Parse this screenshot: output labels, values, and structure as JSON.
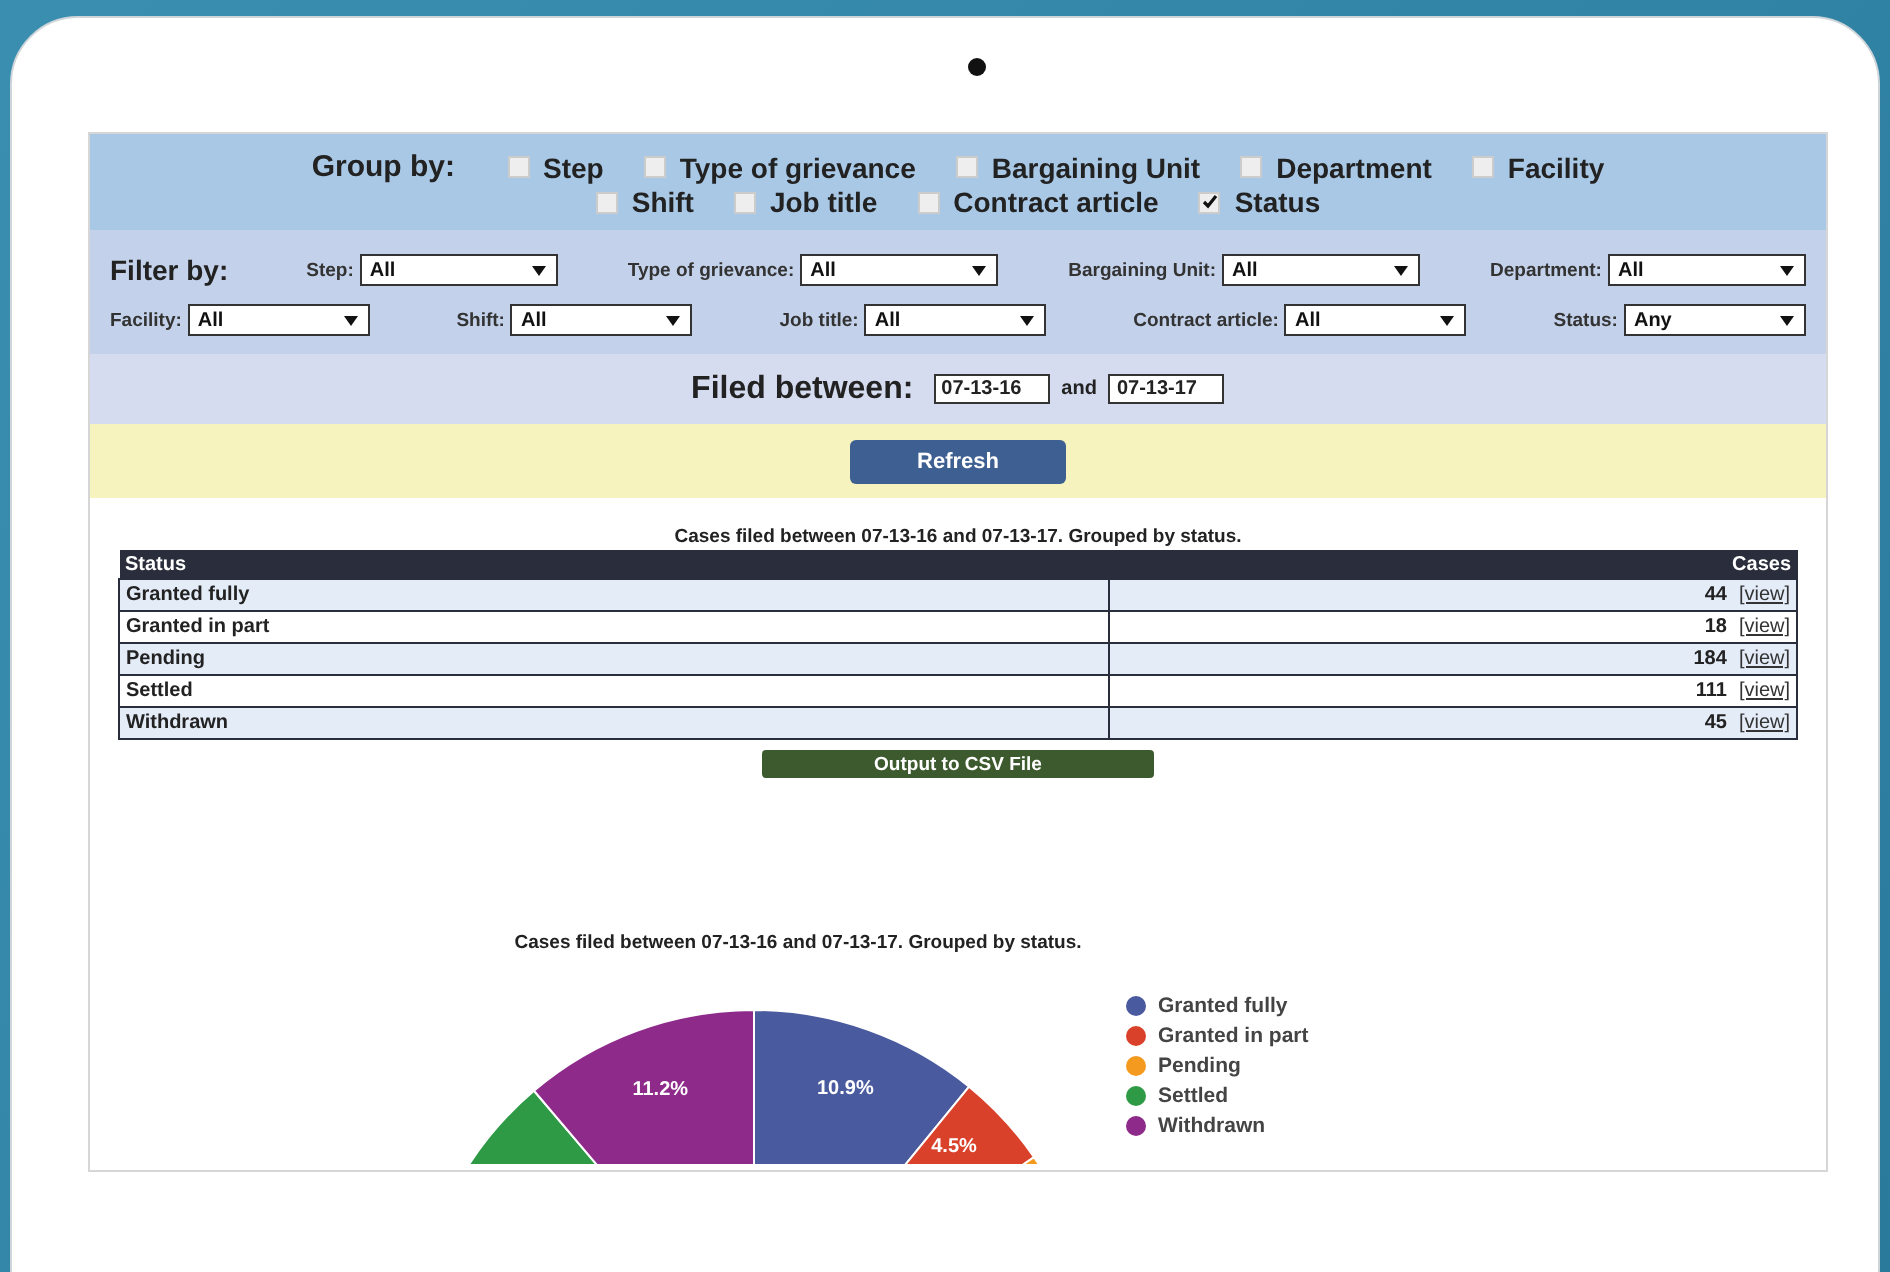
{
  "group_by": {
    "label": "Group by:",
    "rows": [
      {
        "options": [
          {
            "label": "Step",
            "checked": false
          },
          {
            "label": "Type of grievance",
            "checked": false
          },
          {
            "label": "Bargaining Unit",
            "checked": false
          },
          {
            "label": "Department",
            "checked": false
          },
          {
            "label": "Facility",
            "checked": false
          }
        ]
      },
      {
        "options": [
          {
            "label": "Shift",
            "checked": false
          },
          {
            "label": "Job title",
            "checked": false
          },
          {
            "label": "Contract article",
            "checked": false
          },
          {
            "label": "Status",
            "checked": true
          }
        ]
      }
    ]
  },
  "filter_by": {
    "label": "Filter by:",
    "rows": [
      {
        "filters": [
          {
            "label": "Step:",
            "value": "All"
          },
          {
            "label": "Type of grievance:",
            "value": "All"
          },
          {
            "label": "Bargaining Unit:",
            "value": "All"
          },
          {
            "label": "Department:",
            "value": "All"
          }
        ]
      },
      {
        "filters": [
          {
            "label": "Facility:",
            "value": "All"
          },
          {
            "label": "Shift:",
            "value": "All"
          },
          {
            "label": "Job title:",
            "value": "All"
          },
          {
            "label": "Contract article:",
            "value": "All"
          },
          {
            "label": "Status:",
            "value": "Any"
          }
        ]
      }
    ]
  },
  "filed_between": {
    "label": "Filed between:",
    "from": "07-13-16",
    "and_label": "and",
    "to": "07-13-17"
  },
  "refresh_button": "Refresh",
  "table": {
    "caption": "Cases filed between 07-13-16 and 07-13-17. Grouped by status.",
    "columns": [
      "Status",
      "Cases"
    ],
    "rows": [
      {
        "status": "Granted fully",
        "cases": "44",
        "link": "[view]"
      },
      {
        "status": "Granted in part",
        "cases": "18",
        "link": "[view]"
      },
      {
        "status": "Pending",
        "cases": "184",
        "link": "[view]"
      },
      {
        "status": "Settled",
        "cases": "111",
        "link": "[view]"
      },
      {
        "status": "Withdrawn",
        "cases": "45",
        "link": "[view]"
      }
    ]
  },
  "csv_button": "Output to CSV File",
  "chart": {
    "chart_data": {
      "type": "pie",
      "title": "Cases filed between 07-13-16 and 07-13-17. Grouped by status.",
      "categories": [
        "Granted fully",
        "Granted in part",
        "Pending",
        "Settled",
        "Withdrawn"
      ],
      "values": [
        10.9,
        4.5,
        45.8,
        27.6,
        11.2
      ],
      "colors": [
        "#4a5a9e",
        "#d9412b",
        "#f39a1f",
        "#2e9a45",
        "#8e2a8a"
      ],
      "value_labels": [
        "10.9%",
        "4.5%",
        null,
        null,
        "11.2%"
      ],
      "legend": "right"
    }
  }
}
